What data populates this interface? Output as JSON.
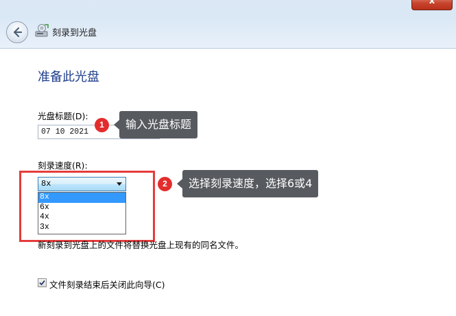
{
  "window": {
    "close_label": "x",
    "nav_title": "刻录到光盘"
  },
  "content": {
    "heading": "准备此光盘",
    "disc_title_label": "光盘标题(D):",
    "disc_title_value": "07 10 2021",
    "speed_label": "刻录速度(R):",
    "speed_selected": "8x",
    "speed_options": [
      "8x",
      "6x",
      "4x",
      "3x"
    ],
    "note": "新刻录到光盘上的文件将替换光盘上现有的同名文件。",
    "checkbox_label": "文件刻录结束后关闭此向导(C)",
    "checkbox_checked": true
  },
  "annotations": {
    "badge1": "1",
    "callout1": "输入光盘标题",
    "badge2": "2",
    "callout2": "选择刻录速度，选择6或4",
    "accent_color": "#e32d2d"
  }
}
